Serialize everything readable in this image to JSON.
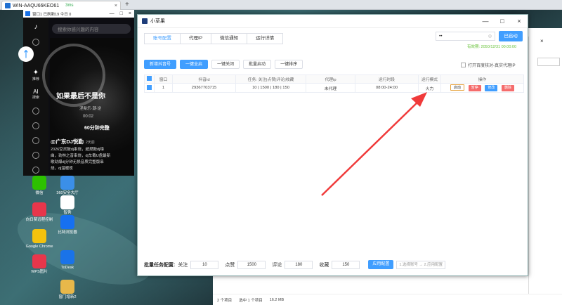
{
  "browser": {
    "tab_title": "WIN-AAQU66KEO61",
    "tab_signal": "3ms",
    "tab_close": "×",
    "new_tab": "+"
  },
  "douyin": {
    "window_title": "窗口1 已刷新19 今日 0",
    "search_placeholder": "搜索你感兴趣的内容",
    "side_recommend": "推荐",
    "side_ai": "AI",
    "side_ai_sub": "搜索",
    "video_title": "如果最后不是你",
    "video_sub1": "涅槃乐·潮·逆",
    "video_time": "00:02",
    "video_tag": "60分钟完整",
    "author": "@广东DJ悦勤",
    "author_date": "· 2天前",
    "desc": "2026空灵鼓dj串烧，超燃鼓dj嗨曲，劲林之音串烧，dj车载U盘最新歌劲爆dj分钟无损音质完整版串烧，dj温暖夜"
  },
  "desktop_icons": [
    {
      "label": "微信",
      "color": "#2dc100"
    },
    {
      "label": "360安全大厅",
      "color": "#3b8fe8"
    },
    {
      "label": "向日葵远程控制",
      "color": "#e8364b"
    },
    {
      "label": "智秀",
      "color": "#ffffff"
    },
    {
      "label": "Google Chrome",
      "color": "#f4c20d"
    },
    {
      "label": "比特浏览器",
      "color": "#1670f0"
    },
    {
      "label": "WPS图片",
      "color": "#e8364b"
    },
    {
      "label": "ToDesk",
      "color": "#1a73e8"
    },
    {
      "label": "窗门增新2",
      "color": "#e8b84a"
    }
  ],
  "app": {
    "title": "小草果",
    "tabs": [
      "账号配置",
      "代理IP",
      "微信通知",
      "运行详情"
    ],
    "active_tab": 0,
    "key_value": "••",
    "started_label": "已启动",
    "expire_text": "有效期: 2050/12/31 00:00:00",
    "toolbar": {
      "add_account": "新增抖音号",
      "one_click_start": "一键全启",
      "one_click_close": "一键关闭",
      "batch_start": "批量启动",
      "one_click_sort": "一键排序"
    },
    "proxy_check_label": "打开百度核对-真实代理IP",
    "table": {
      "headers": [
        "窗口",
        "抖音id",
        "任务: 关注|点赞|评论|收藏",
        "代理ip",
        "运行时段",
        "运行模式",
        "操作"
      ],
      "rows": [
        {
          "window": "1",
          "douyin_id": "29367703715",
          "task": "10 | 1500 | 180 | 150",
          "proxy": "未代理",
          "period": "08:00-24:00",
          "mode": "火力"
        }
      ],
      "actions": {
        "start": "启动",
        "pause": "暂停",
        "edit": "修改",
        "delete": "删除"
      }
    },
    "batch": {
      "label": "批量任务配置:",
      "follow_label": "关注",
      "follow": "10",
      "like_label": "点赞",
      "like": "1500",
      "comment_label": "评论",
      "comment": "180",
      "fav_label": "收藏",
      "fav": "150",
      "apply": "应用配置",
      "hint": "1.选择账号 → 2.应用配置"
    }
  },
  "explorer": {
    "items_count": "2 个项目",
    "selected": "选中 1 个项目",
    "size": "16.2 MB"
  },
  "colors": {
    "primary": "#409eff",
    "danger": "#f56c6c",
    "success": "#67c23a",
    "arrow": "#f03a3a"
  }
}
